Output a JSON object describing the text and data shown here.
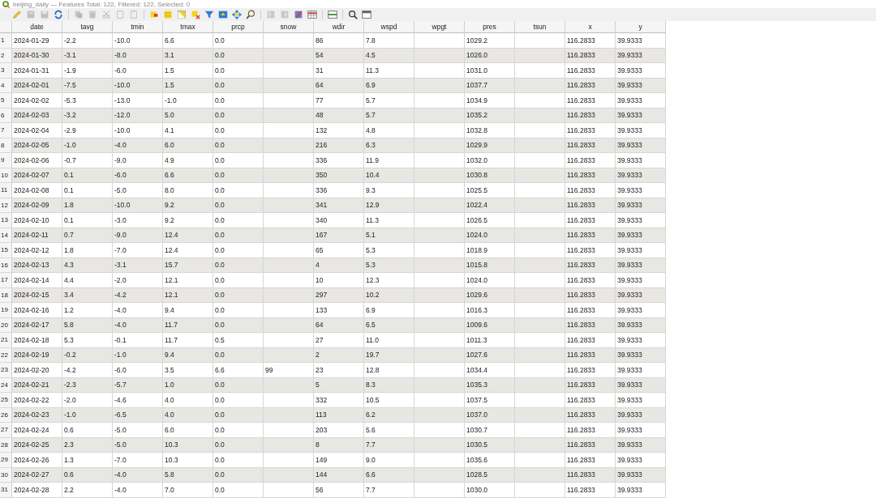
{
  "window": {
    "title": "beijing_daily — Features Total: 122, Filtered: 122, Selected: 0"
  },
  "toolbar": [
    {
      "disabled": false
    },
    {
      "disabled": true
    },
    {
      "disabled": true
    },
    {
      "disabled": false
    },
    {
      "disabled": true
    },
    {
      "disabled": true
    },
    {
      "disabled": true
    },
    {
      "disabled": true
    },
    {
      "disabled": true
    },
    {
      "disabled": false
    },
    {
      "disabled": false
    },
    {
      "disabled": false
    },
    {
      "disabled": false
    },
    {
      "disabled": false
    },
    {
      "disabled": false
    },
    {
      "disabled": false
    },
    {
      "disabled": false
    },
    {
      "disabled": true
    },
    {
      "disabled": true
    },
    {
      "disabled": false
    },
    {
      "disabled": false
    },
    {
      "disabled": false
    },
    {
      "disabled": false
    },
    {
      "disabled": false
    }
  ],
  "table": {
    "columns": [
      "date",
      "tavg",
      "tmin",
      "tmax",
      "prcp",
      "snow",
      "wdir",
      "wspd",
      "wpgt",
      "pres",
      "tsun",
      "x",
      "y"
    ],
    "rows": [
      {
        "number": "1",
        "cells": [
          "2024-01-29",
          "-2.2",
          "-10.0",
          "6.6",
          "0.0",
          null,
          "86",
          "7.8",
          null,
          "1029.2",
          null,
          "116.2833",
          "39.9333"
        ]
      },
      {
        "number": "2",
        "cells": [
          "2024-01-30",
          "-3.1",
          "-8.0",
          "3.1",
          "0.0",
          null,
          "54",
          "4.5",
          null,
          "1026.0",
          null,
          "116.2833",
          "39.9333"
        ]
      },
      {
        "number": "3",
        "cells": [
          "2024-01-31",
          "-1.9",
          "-6.0",
          "1.5",
          "0.0",
          null,
          "31",
          "11.3",
          null,
          "1031.0",
          null,
          "116.2833",
          "39.9333"
        ]
      },
      {
        "number": "4",
        "cells": [
          "2024-02-01",
          "-7.5",
          "-10.0",
          "1.5",
          "0.0",
          null,
          "64",
          "6.9",
          null,
          "1037.7",
          null,
          "116.2833",
          "39.9333"
        ]
      },
      {
        "number": "5",
        "cells": [
          "2024-02-02",
          "-5.3",
          "-13.0",
          "-1.0",
          "0.0",
          null,
          "77",
          "5.7",
          null,
          "1034.9",
          null,
          "116.2833",
          "39.9333"
        ]
      },
      {
        "number": "6",
        "cells": [
          "2024-02-03",
          "-3.2",
          "-12.0",
          "5.0",
          "0.0",
          null,
          "48",
          "5.7",
          null,
          "1035.2",
          null,
          "116.2833",
          "39.9333"
        ]
      },
      {
        "number": "7",
        "cells": [
          "2024-02-04",
          "-2.9",
          "-10.0",
          "4.1",
          "0.0",
          null,
          "132",
          "4.8",
          null,
          "1032.8",
          null,
          "116.2833",
          "39.9333"
        ]
      },
      {
        "number": "8",
        "cells": [
          "2024-02-05",
          "-1.0",
          "-4.0",
          "6.0",
          "0.0",
          null,
          "216",
          "6.3",
          null,
          "1029.9",
          null,
          "116.2833",
          "39.9333"
        ]
      },
      {
        "number": "9",
        "cells": [
          "2024-02-06",
          "-0.7",
          "-9.0",
          "4.9",
          "0.0",
          null,
          "336",
          "11.9",
          null,
          "1032.0",
          null,
          "116.2833",
          "39.9333"
        ]
      },
      {
        "number": "10",
        "cells": [
          "2024-02-07",
          "0.1",
          "-6.0",
          "6.6",
          "0.0",
          null,
          "350",
          "10.4",
          null,
          "1030.8",
          null,
          "116.2833",
          "39.9333"
        ]
      },
      {
        "number": "11",
        "cells": [
          "2024-02-08",
          "0.1",
          "-5.0",
          "8.0",
          "0.0",
          null,
          "336",
          "9.3",
          null,
          "1025.5",
          null,
          "116.2833",
          "39.9333"
        ]
      },
      {
        "number": "12",
        "cells": [
          "2024-02-09",
          "1.8",
          "-10.0",
          "9.2",
          "0.0",
          null,
          "341",
          "12.9",
          null,
          "1022.4",
          null,
          "116.2833",
          "39.9333"
        ]
      },
      {
        "number": "13",
        "cells": [
          "2024-02-10",
          "0.1",
          "-3.0",
          "9.2",
          "0.0",
          null,
          "340",
          "11.3",
          null,
          "1026.5",
          null,
          "116.2833",
          "39.9333"
        ]
      },
      {
        "number": "14",
        "cells": [
          "2024-02-11",
          "0.7",
          "-9.0",
          "12.4",
          "0.0",
          null,
          "167",
          "5.1",
          null,
          "1024.0",
          null,
          "116.2833",
          "39.9333"
        ]
      },
      {
        "number": "15",
        "cells": [
          "2024-02-12",
          "1.8",
          "-7.0",
          "12.4",
          "0.0",
          null,
          "65",
          "5.3",
          null,
          "1018.9",
          null,
          "116.2833",
          "39.9333"
        ]
      },
      {
        "number": "16",
        "cells": [
          "2024-02-13",
          "4.3",
          "-3.1",
          "15.7",
          "0.0",
          null,
          "4",
          "5.3",
          null,
          "1015.8",
          null,
          "116.2833",
          "39.9333"
        ]
      },
      {
        "number": "17",
        "cells": [
          "2024-02-14",
          "4.4",
          "-2.0",
          "12.1",
          "0.0",
          null,
          "10",
          "12.3",
          null,
          "1024.0",
          null,
          "116.2833",
          "39.9333"
        ]
      },
      {
        "number": "18",
        "cells": [
          "2024-02-15",
          "3.4",
          "-4.2",
          "12.1",
          "0.0",
          null,
          "297",
          "10.2",
          null,
          "1029.6",
          null,
          "116.2833",
          "39.9333"
        ]
      },
      {
        "number": "19",
        "cells": [
          "2024-02-16",
          "1.2",
          "-4.0",
          "9.4",
          "0.0",
          null,
          "133",
          "6.9",
          null,
          "1016.3",
          null,
          "116.2833",
          "39.9333"
        ]
      },
      {
        "number": "20",
        "cells": [
          "2024-02-17",
          "5.8",
          "-4.0",
          "11.7",
          "0.0",
          null,
          "64",
          "6.5",
          null,
          "1009.6",
          null,
          "116.2833",
          "39.9333"
        ]
      },
      {
        "number": "21",
        "cells": [
          "2024-02-18",
          "5.3",
          "-0.1",
          "11.7",
          "0.5",
          null,
          "27",
          "11.0",
          null,
          "1011.3",
          null,
          "116.2833",
          "39.9333"
        ]
      },
      {
        "number": "22",
        "cells": [
          "2024-02-19",
          "-0.2",
          "-1.0",
          "9.4",
          "0.0",
          null,
          "2",
          "19.7",
          null,
          "1027.6",
          null,
          "116.2833",
          "39.9333"
        ]
      },
      {
        "number": "23",
        "cells": [
          "2024-02-20",
          "-4.2",
          "-6.0",
          "3.5",
          "6.6",
          "99",
          "23",
          "12.8",
          null,
          "1034.4",
          null,
          "116.2833",
          "39.9333"
        ]
      },
      {
        "number": "24",
        "cells": [
          "2024-02-21",
          "-2.3",
          "-5.7",
          "1.0",
          "0.0",
          null,
          "5",
          "8.3",
          null,
          "1035.3",
          null,
          "116.2833",
          "39.9333"
        ]
      },
      {
        "number": "25",
        "cells": [
          "2024-02-22",
          "-2.0",
          "-4.6",
          "4.0",
          "0.0",
          null,
          "332",
          "10.5",
          null,
          "1037.5",
          null,
          "116.2833",
          "39.9333"
        ]
      },
      {
        "number": "26",
        "cells": [
          "2024-02-23",
          "-1.0",
          "-6.5",
          "4.0",
          "0.0",
          null,
          "113",
          "6.2",
          null,
          "1037.0",
          null,
          "116.2833",
          "39.9333"
        ]
      },
      {
        "number": "27",
        "cells": [
          "2024-02-24",
          "0.6",
          "-5.0",
          "6.0",
          "0.0",
          null,
          "203",
          "5.6",
          null,
          "1030.7",
          null,
          "116.2833",
          "39.9333"
        ]
      },
      {
        "number": "28",
        "cells": [
          "2024-02-25",
          "2.3",
          "-5.0",
          "10.3",
          "0.0",
          null,
          "8",
          "7.7",
          null,
          "1030.5",
          null,
          "116.2833",
          "39.9333"
        ]
      },
      {
        "number": "29",
        "cells": [
          "2024-02-26",
          "1.3",
          "-7.0",
          "10.3",
          "0.0",
          null,
          "149",
          "9.0",
          null,
          "1035.6",
          null,
          "116.2833",
          "39.9333"
        ]
      },
      {
        "number": "30",
        "cells": [
          "2024-02-27",
          "0.6",
          "-4.0",
          "5.8",
          "0.0",
          null,
          "144",
          "6.6",
          null,
          "1028.5",
          null,
          "116.2833",
          "39.9333"
        ]
      },
      {
        "number": "31",
        "cells": [
          "2024-02-28",
          "2.2",
          "-4.0",
          "7.0",
          "0.0",
          null,
          "56",
          "7.7",
          null,
          "1030.0",
          null,
          "116.2833",
          "39.9333"
        ]
      }
    ]
  }
}
